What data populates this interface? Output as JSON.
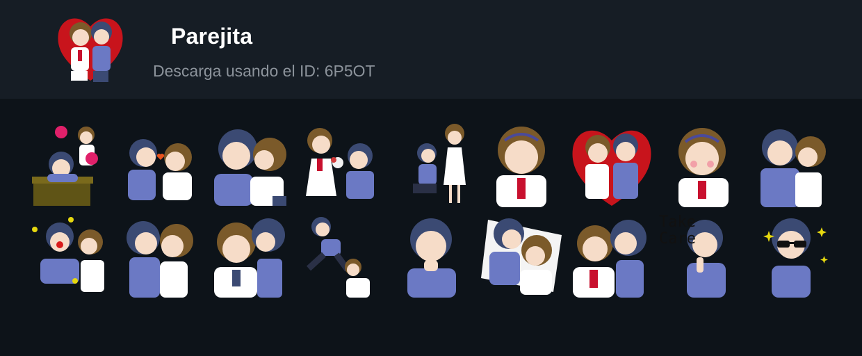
{
  "pack": {
    "title": "Parejita",
    "subtitle": "Descarga usando el ID: 6P5OT",
    "icon": "couple-heart-sticker"
  },
  "colors": {
    "background": "#0d1319",
    "header": "#161d25",
    "boy_shirt": "#6b79c4",
    "boy_hair": "#3b4a73",
    "girl_hair": "#7b5a2a",
    "heart": "#c8141c",
    "bow": "#c8102e"
  },
  "stickers": {
    "row1": [
      {
        "name": "sticker-cheerleader",
        "icon": "cheerleader-desk-sticker"
      },
      {
        "name": "sticker-kiss-heart",
        "icon": "kiss-sticker"
      },
      {
        "name": "sticker-cheek-kiss",
        "icon": "cheek-kiss-sticker"
      },
      {
        "name": "sticker-flowers",
        "icon": "flowers-gift-sticker"
      },
      {
        "name": "sticker-proposal",
        "icon": "kneel-proposal-sticker"
      },
      {
        "name": "sticker-girl-chin",
        "icon": "girl-thinking-sticker"
      },
      {
        "name": "sticker-heart-couple",
        "icon": "couple-heart-sticker"
      },
      {
        "name": "sticker-girl-blush",
        "icon": "girl-blush-sticker"
      },
      {
        "name": "sticker-hug",
        "icon": "hug-sticker"
      }
    ],
    "row2": [
      {
        "name": "sticker-clown-nose",
        "icon": "clown-nose-sticker"
      },
      {
        "name": "sticker-kiss",
        "icon": "kiss-sticker"
      },
      {
        "name": "sticker-surprise-kiss",
        "icon": "surprise-kiss-sticker"
      },
      {
        "name": "sticker-trip",
        "icon": "trip-sticker"
      },
      {
        "name": "sticker-boy-chin",
        "icon": "boy-thinking-sticker"
      },
      {
        "name": "sticker-sleeping",
        "icon": "sleeping-couple-sticker"
      },
      {
        "name": "sticker-pinch",
        "icon": "cheek-pinch-sticker"
      },
      {
        "name": "sticker-take-care",
        "icon": "take-care-sticker",
        "caption": "Take\nCare"
      },
      {
        "name": "sticker-sunglasses",
        "icon": "sunglasses-sticker"
      }
    ]
  }
}
